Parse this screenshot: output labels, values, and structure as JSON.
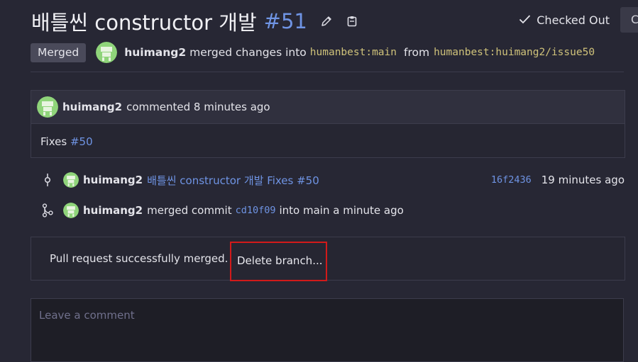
{
  "header": {
    "title": "배틀씬 constructor 개발",
    "pr_number": "#51",
    "checkout_label": "Checked Out",
    "edge_button_label": "C"
  },
  "status": {
    "badge": "Merged",
    "author": "huimang2",
    "merged_text": "merged changes into",
    "target_branch": "humanbest:main",
    "from_text": "from",
    "source_branch": "humanbest:huimang2/issue50"
  },
  "comment": {
    "author": "huimang2",
    "meta": "commented 8 minutes ago",
    "body_text": "Fixes",
    "body_link": "#50"
  },
  "timeline": {
    "commit": {
      "author": "huimang2",
      "message": "배틀씬 constructor 개발 Fixes #50",
      "sha": "16f2436",
      "time": "19 minutes ago"
    },
    "merge": {
      "author": "huimang2",
      "text_before": "merged commit",
      "sha": "cd10f09",
      "text_after": "into main a minute ago"
    }
  },
  "merge_box": {
    "message": "Pull request successfully merged.",
    "delete_branch_label": "Delete branch..."
  },
  "comment_input": {
    "placeholder": "Leave a comment",
    "value": ""
  },
  "colors": {
    "background": "#272734",
    "link": "#6f94e4",
    "branch": "#cfc27a",
    "highlight_border": "#d21a1a",
    "avatar": "#8fd47a"
  },
  "icons": {
    "edit": "pencil-icon",
    "copy": "clipboard-icon",
    "check": "check-icon",
    "commit": "git-commit-icon",
    "merge": "git-merge-icon"
  }
}
